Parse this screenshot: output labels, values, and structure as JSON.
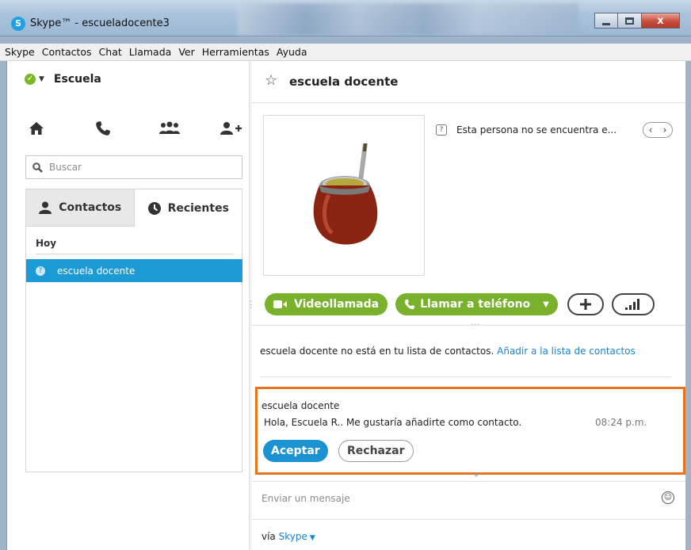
{
  "window": {
    "title": "Skype™ - escueladocente3",
    "app_icon_letter": "S",
    "close_symbol": "x"
  },
  "menu": [
    "Skype",
    "Contactos",
    "Chat",
    "Llamada",
    "Ver",
    "Herramientas",
    "Ayuda"
  ],
  "left": {
    "status_name": "Escuela",
    "status_color": "#7bb72b",
    "nav_icons": [
      "home-icon",
      "phone-icon",
      "group-icon",
      "add-contact-icon"
    ],
    "search_placeholder": "Buscar",
    "tabs": {
      "contacts": "Contactos",
      "recent": "Recientes"
    },
    "group_header": "Hoy",
    "contact_name": "escuela docente",
    "selected_color": "#1b9ad6"
  },
  "right": {
    "contact_name": "escuela docente",
    "status_message": "Esta persona no se encuentra e...",
    "buttons": {
      "video": "Videollamada",
      "call": "Llamar a teléfono"
    },
    "notice_text": "escuela docente no está en tu lista de contactos.",
    "notice_link": "Añadir a la lista de contactos",
    "request": {
      "from": "escuela docente",
      "message": "Hola, Escuela R.. Me gustaría añadirte como contacto.",
      "time": "08:24 p.m.",
      "accept": "Aceptar",
      "reject": "Rechazar",
      "highlight_color": "#e8731f"
    },
    "message_placeholder": "Enviar un mensaje",
    "via_label": "vía",
    "via_link": "Skype"
  },
  "colors": {
    "accent_green": "#79b12d",
    "accent_blue": "#1b92d1",
    "link": "#1b84c9"
  }
}
